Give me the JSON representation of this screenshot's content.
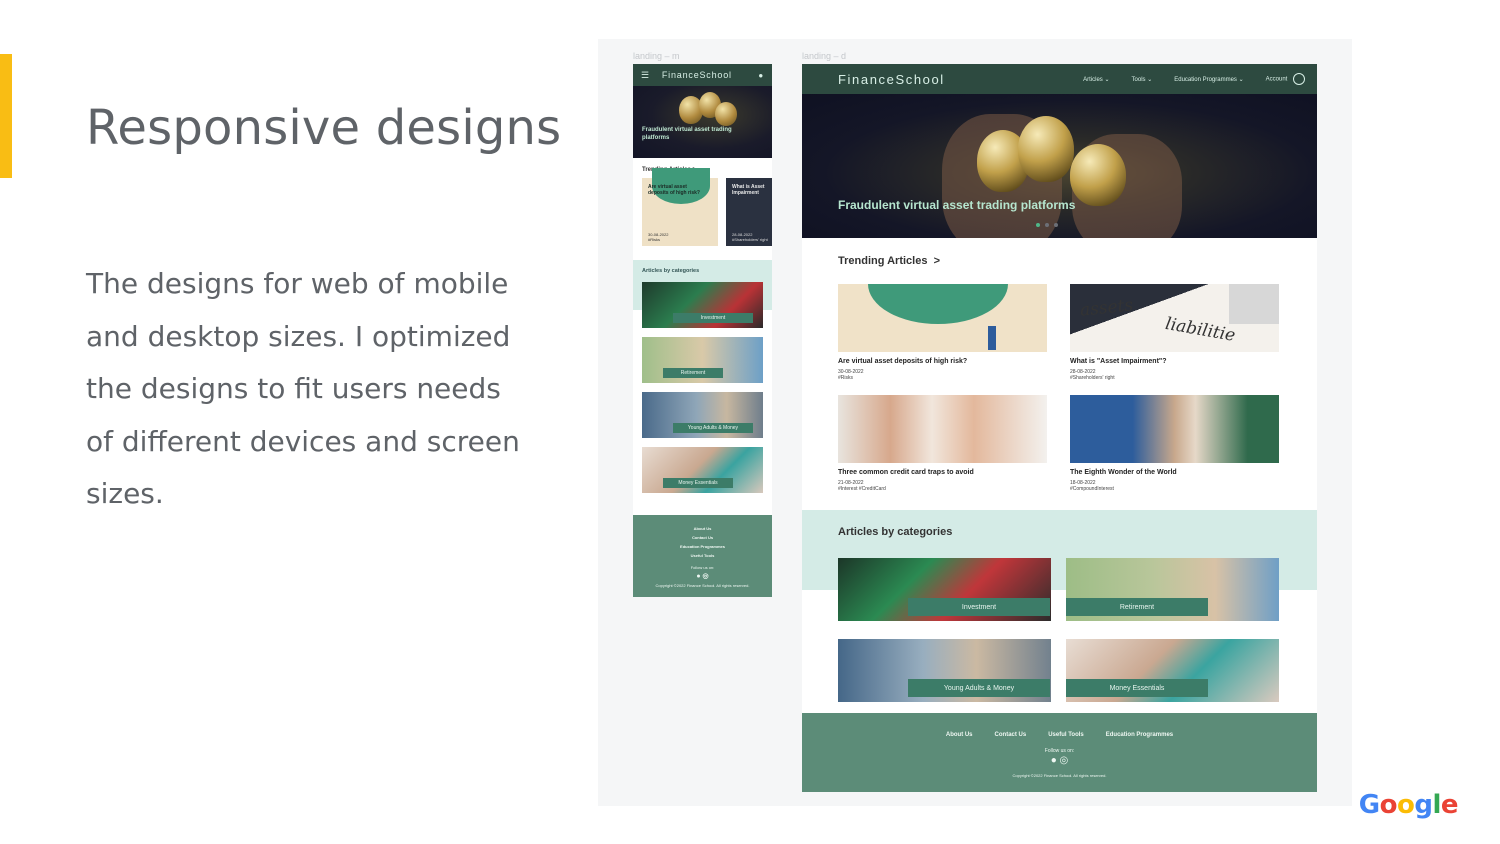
{
  "slide": {
    "title": "Responsive designs",
    "body": "The designs for web of mobile and desktop sizes. I optimized the designs to fit users needs of different devices and screen sizes.",
    "logo": [
      "G",
      "o",
      "o",
      "g",
      "l",
      "e"
    ],
    "logo_colors": [
      "#4285F4",
      "#EA4335",
      "#FBBC05",
      "#4285F4",
      "#34A853",
      "#EA4335"
    ],
    "accent_color": "#F9BD14"
  },
  "frames": {
    "mobile_label": "landing – m",
    "desktop_label": "landing – d"
  },
  "brand": "FinanceSchool",
  "nav": {
    "items": [
      "Articles",
      "Tools",
      "Education Programmes"
    ],
    "account": "Account",
    "menu_icon": "hamburger-icon",
    "account_icon": "user-icon"
  },
  "hero": {
    "title": "Fraudulent virtual asset trading platforms"
  },
  "trending": {
    "title": "Trending Articles",
    "arrow": ">",
    "articles": [
      {
        "title": "Are virtual asset deposits of high risk?",
        "date": "30-08-2022",
        "tags": "#Risks"
      },
      {
        "title": "What is \"Asset Impairment\"?",
        "date": "28-08-2022",
        "tags": "#Shareholders' right"
      },
      {
        "title": "Three common credit card traps to avoid",
        "date": "21-08-2022",
        "tags": "#Interest #CreditCard"
      },
      {
        "title": "The Eighth Wonder of the World",
        "date": "18-08-2022",
        "tags": "#CompoundInterest"
      }
    ],
    "mobile_card_2": "What is Asset Impairment"
  },
  "categories": {
    "title": "Articles by categories",
    "items": [
      "Investment",
      "Retirement",
      "Young Adults & Money",
      "Money Essentials"
    ]
  },
  "footer": {
    "links": [
      "About Us",
      "Contact Us",
      "Useful Tools",
      "Education Programmes"
    ],
    "mobile_links": [
      "About Us",
      "Contact Us",
      "Education Programmes",
      "Useful Tools"
    ],
    "follow": "Follow us on:",
    "social_icons": [
      "facebook-icon",
      "instagram-icon"
    ],
    "copyright": "Copyright ©2022 Finance School. All rights reserved."
  }
}
